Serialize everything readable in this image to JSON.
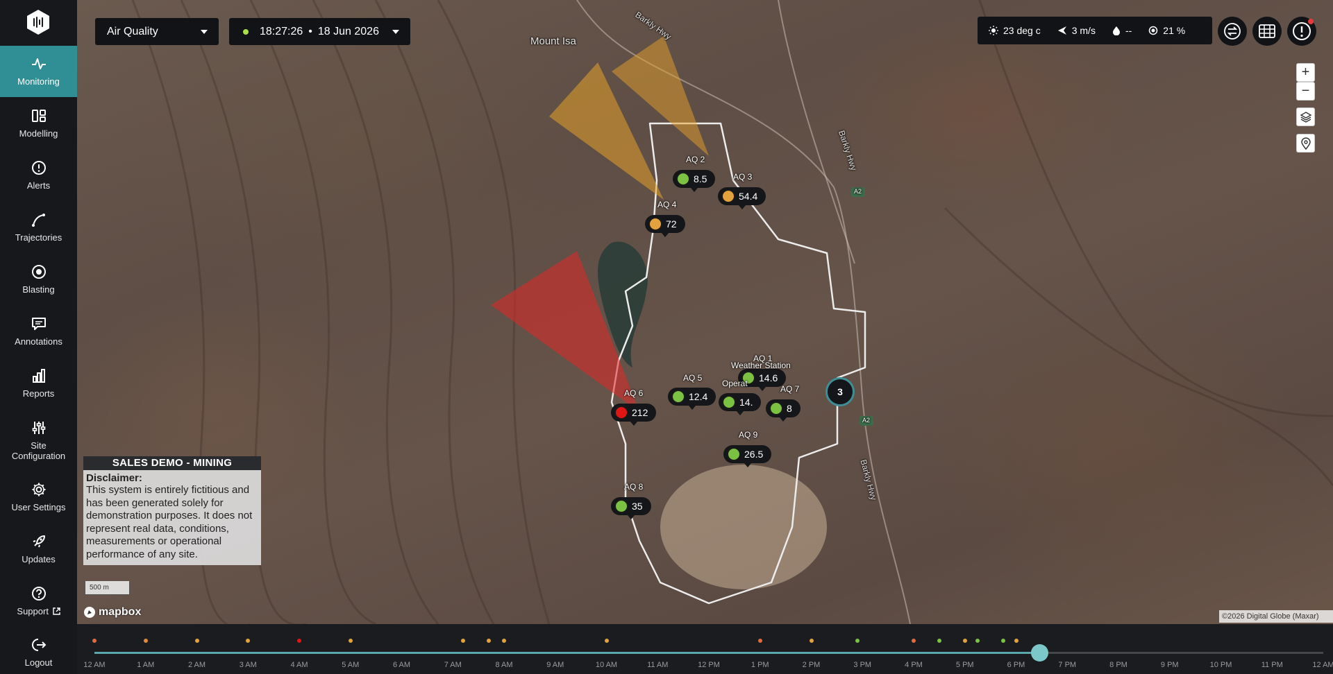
{
  "nav": {
    "items": [
      {
        "label": "Monitoring",
        "icon": "pulse-icon",
        "active": true
      },
      {
        "label": "Modelling",
        "icon": "modelling-icon"
      },
      {
        "label": "Alerts",
        "icon": "alert-icon"
      },
      {
        "label": "Trajectories",
        "icon": "trajectory-icon"
      },
      {
        "label": "Blasting",
        "icon": "target-icon"
      },
      {
        "label": "Annotations",
        "icon": "comment-icon"
      },
      {
        "label": "Reports",
        "icon": "bar-chart-icon"
      },
      {
        "label": "Site Configuration",
        "icon": "sliders-icon"
      },
      {
        "label": "User Settings",
        "icon": "gear-icon"
      },
      {
        "label": "Updates",
        "icon": "rocket-icon"
      },
      {
        "label": "Support",
        "icon": "help-icon"
      },
      {
        "label": "Logout",
        "icon": "logout-icon"
      }
    ]
  },
  "toolbar": {
    "layer": "Air Quality",
    "time": "18:27:26",
    "date": "18 Jun 2026"
  },
  "weather": {
    "temperature": "23 deg c",
    "wind": "3 m/s",
    "rain": "--",
    "humidity": "21 %"
  },
  "map": {
    "place_label": "Mount Isa",
    "road_labels": [
      "Barkly Hwy",
      "Barkly Hwy",
      "Barkly Hwy"
    ],
    "road_shields": [
      "A2",
      "A2"
    ],
    "cluster_count": "3",
    "weather_station_label": "Weather Station",
    "operations_label": "Operat",
    "sensors": [
      {
        "name": "AQ 2",
        "value": "8.5",
        "status": "good",
        "color": "#7cc242"
      },
      {
        "name": "AQ 3",
        "value": "54.4",
        "status": "moderate",
        "color": "#e3a23c"
      },
      {
        "name": "AQ 4",
        "value": "72",
        "status": "moderate",
        "color": "#e3a23c"
      },
      {
        "name": "AQ 5",
        "value": "12.4",
        "status": "good",
        "color": "#7cc242"
      },
      {
        "name": "AQ 1",
        "value": "14.6",
        "status": "good",
        "color": "#7cc242"
      },
      {
        "name": "AQ 6",
        "value": "212",
        "status": "alert",
        "color": "#e01616"
      },
      {
        "name": "AQ 7",
        "value": "8",
        "status": "good",
        "color": "#7cc242"
      },
      {
        "name": "AQ 9",
        "value": "26.5",
        "status": "good",
        "color": "#7cc242"
      },
      {
        "name": "AQ 8",
        "value": "35",
        "status": "good",
        "color": "#7cc242"
      },
      {
        "name": "",
        "value": "14.",
        "status": "good",
        "color": "#7cc242"
      }
    ],
    "disclaimer": {
      "title": "SALES DEMO - MINING",
      "heading": "Disclaimer:",
      "body": "This system is entirely fictitious and has been generated solely for demonstration purposes. It does not represent real data, conditions, measurements or operational performance of any site."
    },
    "scale": "500 m",
    "brand": "mapbox",
    "attribution": "©2026 Digital Globe (Maxar)"
  },
  "timeline": {
    "ticks": [
      "12 AM",
      "1 AM",
      "2 AM",
      "3 AM",
      "4 AM",
      "5 AM",
      "6 AM",
      "7 AM",
      "8 AM",
      "9 AM",
      "10 AM",
      "11 AM",
      "12 PM",
      "1 PM",
      "2 PM",
      "3 PM",
      "4 PM",
      "5 PM",
      "6 PM",
      "7 PM",
      "8 PM",
      "9 PM",
      "10 PM",
      "11 PM",
      "12 AM"
    ],
    "current_hour": 18.45,
    "events": [
      {
        "hour": 0.0,
        "color": "#e06c3a"
      },
      {
        "hour": 1.0,
        "color": "#e08a3a"
      },
      {
        "hour": 2.0,
        "color": "#e3a23c"
      },
      {
        "hour": 3.0,
        "color": "#e3a23c"
      },
      {
        "hour": 4.0,
        "color": "#e01616"
      },
      {
        "hour": 5.0,
        "color": "#e3a23c"
      },
      {
        "hour": 7.2,
        "color": "#e3a23c"
      },
      {
        "hour": 7.7,
        "color": "#e3a23c"
      },
      {
        "hour": 8.0,
        "color": "#e3a23c"
      },
      {
        "hour": 10.0,
        "color": "#e3a23c"
      },
      {
        "hour": 13.0,
        "color": "#e06c3a"
      },
      {
        "hour": 14.0,
        "color": "#e3a23c"
      },
      {
        "hour": 14.9,
        "color": "#7cc242"
      },
      {
        "hour": 16.0,
        "color": "#e06c3a"
      },
      {
        "hour": 16.5,
        "color": "#7cc242"
      },
      {
        "hour": 17.0,
        "color": "#e3a23c"
      },
      {
        "hour": 17.25,
        "color": "#7cc242"
      },
      {
        "hour": 17.75,
        "color": "#7cc242"
      },
      {
        "hour": 18.0,
        "color": "#e3a23c"
      }
    ]
  },
  "colors": {
    "accent": "#2f8f95",
    "good": "#7cc242",
    "moderate": "#e3a23c",
    "alert": "#e01616"
  }
}
